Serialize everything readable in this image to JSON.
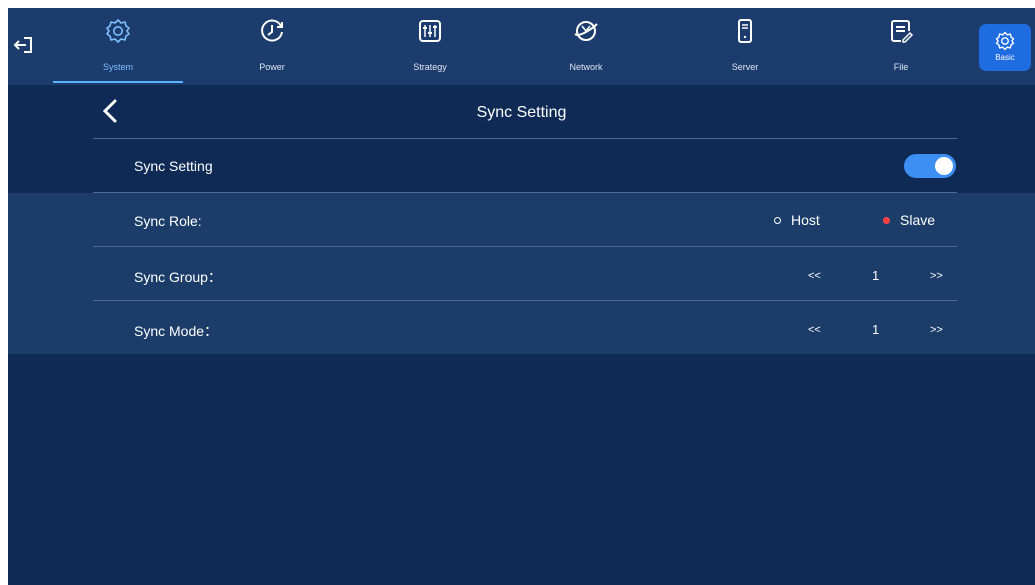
{
  "nav": {
    "tabs": [
      {
        "label": "System",
        "icon": "gear-icon",
        "active": true
      },
      {
        "label": "Power",
        "icon": "power-timer-icon"
      },
      {
        "label": "Strategy",
        "icon": "sliders-icon"
      },
      {
        "label": "Network",
        "icon": "network-icon"
      },
      {
        "label": "Server",
        "icon": "server-icon"
      },
      {
        "label": "File",
        "icon": "file-icon"
      }
    ],
    "basic_label": "Basic"
  },
  "page": {
    "title": "Sync Setting"
  },
  "sync_setting": {
    "label": "Sync Setting",
    "enabled": true
  },
  "sync_role": {
    "label": "Sync Role:",
    "options": [
      "Host",
      "Slave"
    ],
    "selected": "Slave"
  },
  "sync_group": {
    "label": "Sync Group：",
    "prev": "<<",
    "value": "1",
    "next": ">>"
  },
  "sync_mode": {
    "label": "Sync Mode：",
    "prev": "<<",
    "value": "1",
    "next": ">>"
  },
  "colors": {
    "background": "#0e2a55",
    "topbar": "#1b3c6c",
    "accent": "#3d8ff4",
    "selected_radio": "#ff3b3b"
  }
}
